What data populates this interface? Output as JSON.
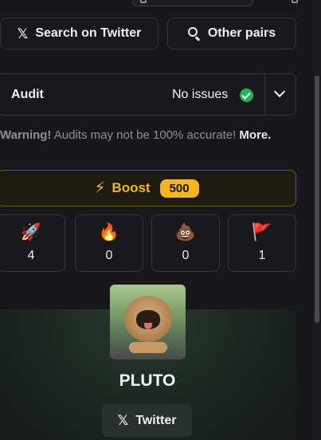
{
  "actions": {
    "search_twitter": "Search on Twitter",
    "other_pairs": "Other pairs"
  },
  "audit": {
    "label": "Audit",
    "status": "No issues"
  },
  "warning": {
    "bold": "Warning!",
    "text": " Audits may not be 100% accurate! ",
    "more": "More."
  },
  "boost": {
    "label": "Boost",
    "count": "500"
  },
  "reactions": [
    {
      "icon": "rocket",
      "emoji": "🚀",
      "count": "4"
    },
    {
      "icon": "fire",
      "emoji": "🔥",
      "count": "0"
    },
    {
      "icon": "poop",
      "emoji": "💩",
      "count": "0"
    },
    {
      "icon": "red-flag",
      "emoji": "🚩",
      "count": "1"
    }
  ],
  "token": {
    "name": "PLUTO",
    "twitter_label": "Twitter"
  },
  "colors": {
    "background": "#17171c",
    "accent_boost": "#f5b619",
    "status_ok": "#1fb35a"
  },
  "icons": {
    "x_glyph": "𝕏"
  }
}
